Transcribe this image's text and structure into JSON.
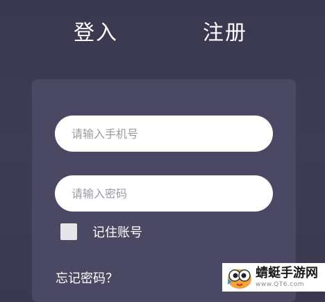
{
  "tabs": {
    "login": "登入",
    "register": "注册"
  },
  "form": {
    "phone_placeholder": "请输入手机号",
    "password_placeholder": "请输入密码",
    "remember_label": "记住账号",
    "remember_checked": false,
    "forgot_label": "忘记密码？"
  },
  "watermark": {
    "name": "蜻蜓手游网",
    "url": "www.QT6.com"
  },
  "colors": {
    "background": "#3f3d55",
    "card": "#4a4862",
    "text": "#ffffff",
    "placeholder": "#9a9aa4"
  }
}
